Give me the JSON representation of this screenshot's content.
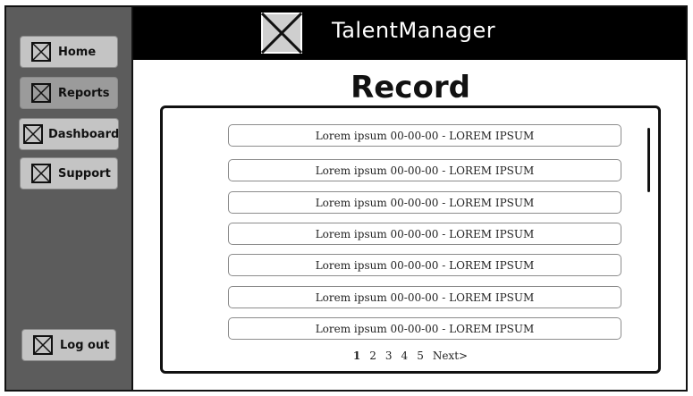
{
  "header": {
    "title": "TalentManager"
  },
  "page": {
    "title": "Record"
  },
  "sidebar": {
    "items": [
      {
        "label": "Home"
      },
      {
        "label": "Reports"
      },
      {
        "label": "Dashboard"
      },
      {
        "label": "Support"
      }
    ],
    "logout_label": "Log out"
  },
  "records": [
    "Lorem ipsum 00-00-00 - LOREM IPSUM",
    "Lorem ipsum 00-00-00 - LOREM IPSUM",
    "Lorem ipsum 00-00-00 - LOREM IPSUM",
    "Lorem ipsum 00-00-00 - LOREM IPSUM",
    "Lorem ipsum 00-00-00 - LOREM IPSUM",
    "Lorem ipsum 00-00-00 - LOREM IPSUM",
    "Lorem ipsum 00-00-00 - LOREM IPSUM"
  ],
  "pagination": {
    "pages": [
      "1",
      "2",
      "3",
      "4",
      "5"
    ],
    "current": "1",
    "next_label": "Next>"
  },
  "icons": {
    "nav": "placeholder-image-icon",
    "logo": "placeholder-image-icon"
  }
}
